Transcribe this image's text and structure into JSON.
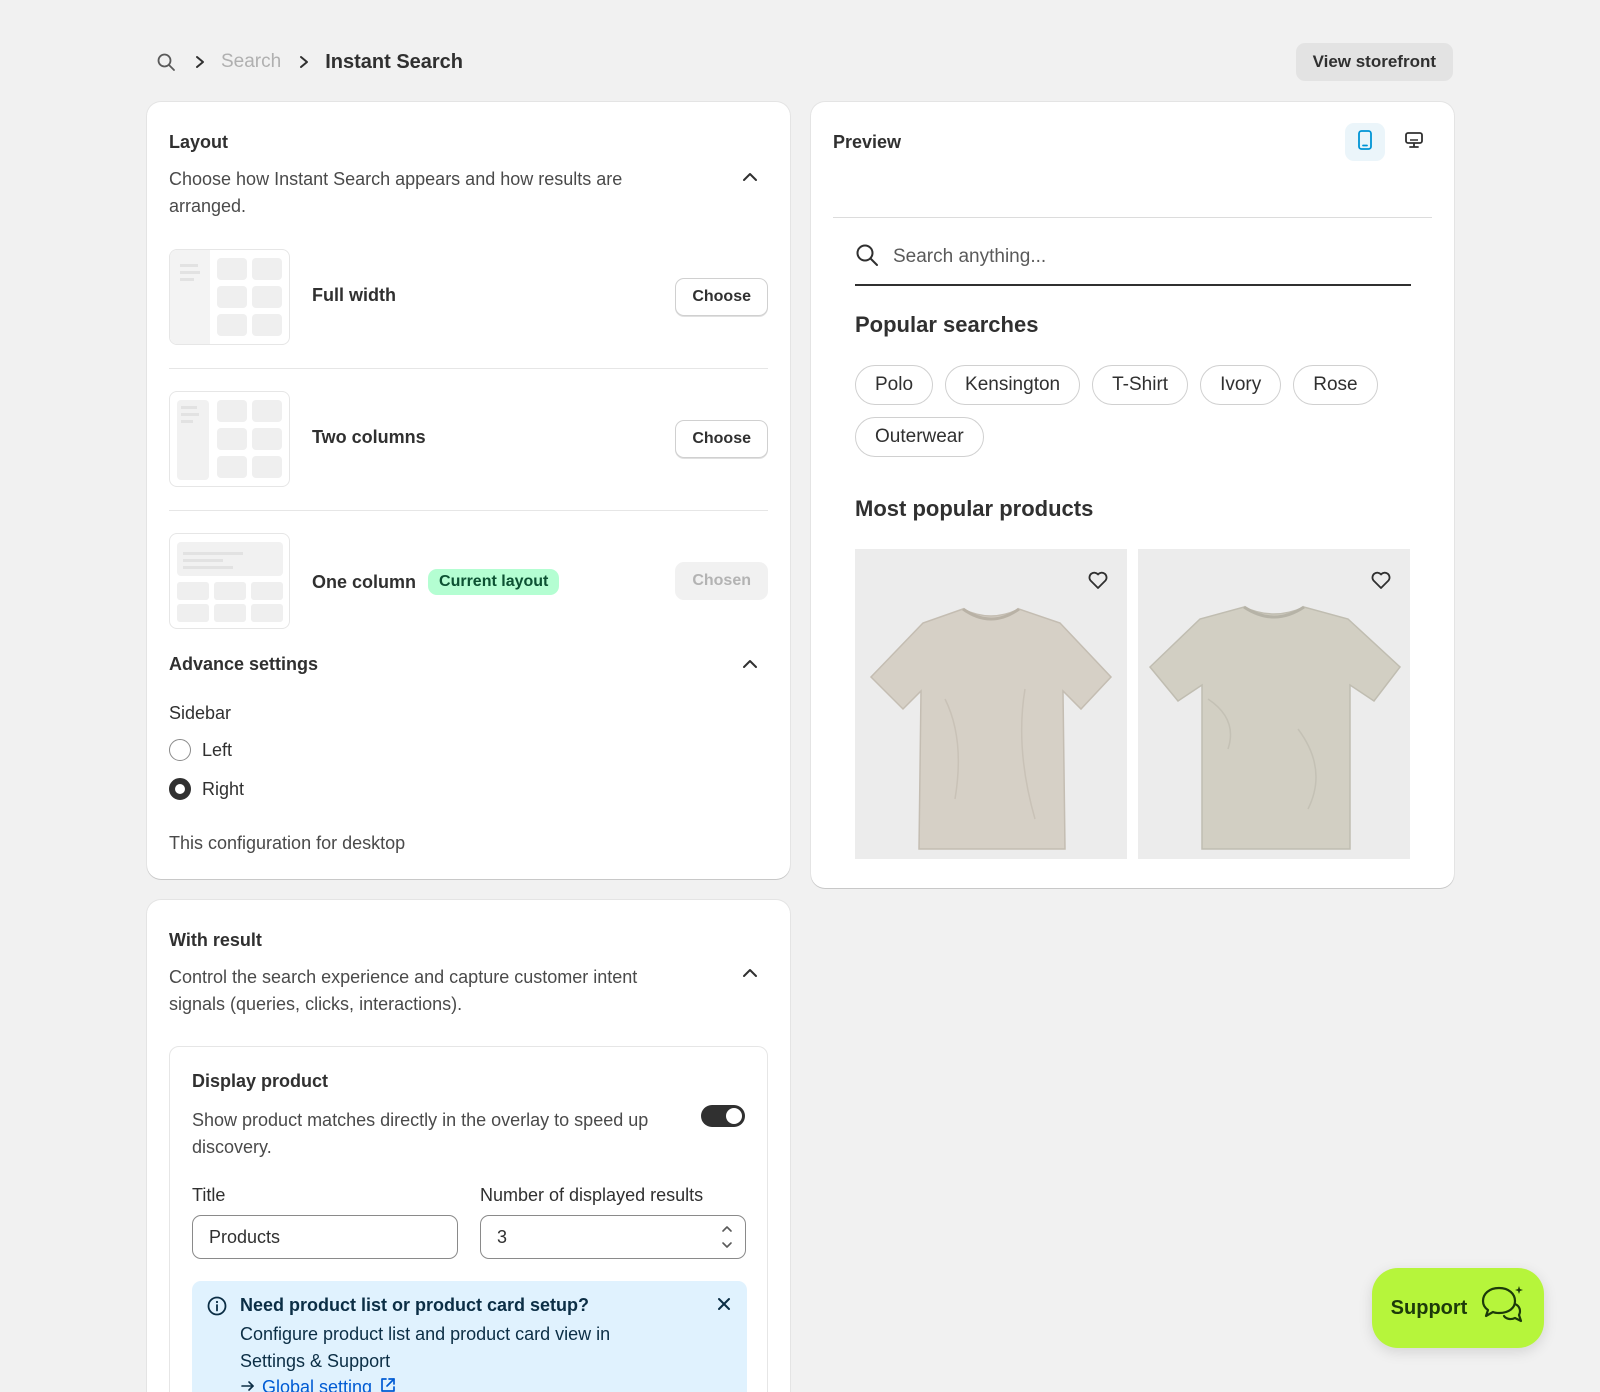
{
  "breadcrumb": {
    "parent": "Search",
    "current": "Instant Search"
  },
  "header": {
    "view_storefront": "View storefront"
  },
  "layout": {
    "title": "Layout",
    "description": "Choose how Instant Search appears and how results are arranged.",
    "options": [
      {
        "label": "Full width",
        "button": "Choose"
      },
      {
        "label": "Two columns",
        "button": "Choose"
      },
      {
        "label": "One column",
        "badge": "Current layout",
        "button": "Chosen"
      }
    ],
    "advance": {
      "title": "Advance settings",
      "sidebar_label": "Sidebar",
      "options": [
        "Left",
        "Right"
      ],
      "selected": "Right",
      "note": "This configuration for desktop"
    }
  },
  "preview": {
    "title": "Preview",
    "search_placeholder": "Search anything...",
    "popular_title": "Popular searches",
    "popular": [
      "Polo",
      "Kensington",
      "T-Shirt",
      "Ivory",
      "Rose",
      "Outerwear"
    ],
    "products_title": "Most popular products"
  },
  "result": {
    "title": "With result",
    "description": "Control the search experience and capture customer intent signals (queries, clicks, interactions).",
    "display": {
      "title": "Display product",
      "description": "Show product matches directly in the overlay to speed up discovery.",
      "enabled": true,
      "title_label": "Title",
      "title_value": "Products",
      "count_label": "Number of displayed results",
      "count_value": "3"
    },
    "banner": {
      "title": "Need product list or product card setup?",
      "text": "Configure product list and product card view in Settings & Support",
      "link": "Global setting"
    }
  },
  "support": {
    "label": "Support"
  },
  "colors": {
    "badge_bg": "#b4fed2",
    "support_bg": "#b6f53b",
    "banner_bg": "#e0f2fe",
    "link": "#005bd3"
  }
}
